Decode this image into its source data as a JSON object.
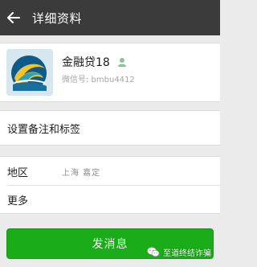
{
  "header": {
    "title": "详细资料",
    "back_icon": "back-arrow-icon"
  },
  "profile": {
    "name": "金融贷18",
    "wechat_id": "微信号: bmbu4412",
    "gender_icon": "male-icon"
  },
  "rows": {
    "remark_label": "设置备注和标签",
    "region_label": "地区",
    "region_value": "上海  嘉定",
    "more_label": "更多"
  },
  "actions": {
    "send_message": "发消息"
  },
  "watermark": {
    "text": "至道终结诈骗"
  },
  "colors": {
    "header_bg": "#3b3b3b",
    "page_bg": "#ebebeb",
    "button_green": "#1aad19"
  }
}
